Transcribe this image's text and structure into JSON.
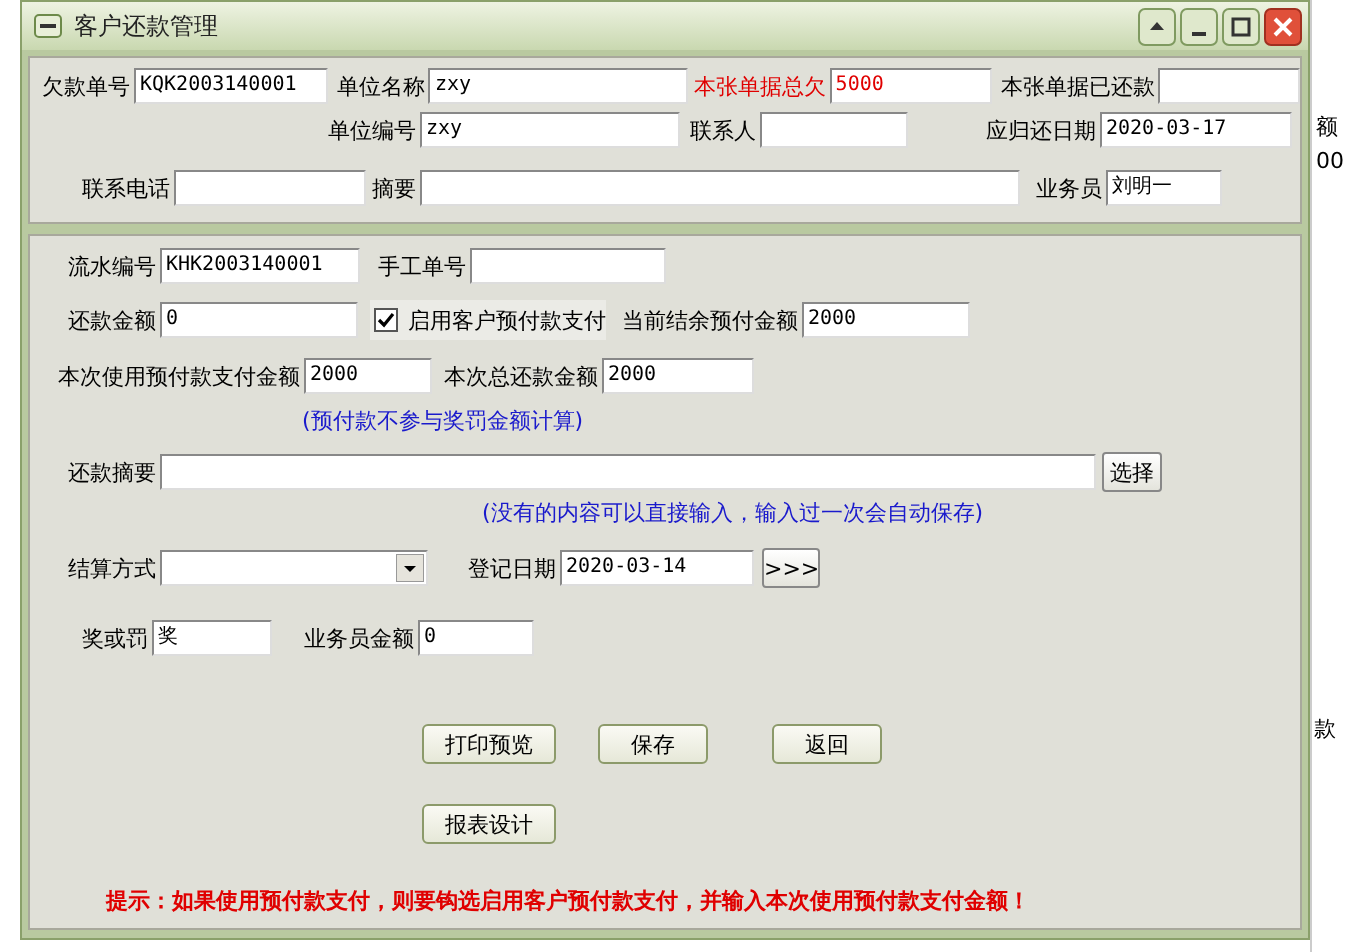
{
  "window": {
    "title": "客户还款管理"
  },
  "header": {
    "fields": [
      {
        "label": "欠款单号",
        "value": "KQK2003140001"
      },
      {
        "label": "单位名称",
        "value": "zxy"
      },
      {
        "label": "本张单据总欠",
        "value": "5000",
        "color": "#e00000"
      },
      {
        "label": "本张单据已还款"
      },
      {
        "label": "单位编号",
        "value": "zxy"
      },
      {
        "label": "联系人"
      },
      {
        "label": "应归还日期",
        "value": "2020-03-17"
      },
      {
        "label": "联系电话"
      },
      {
        "label": "摘要"
      },
      {
        "label": "业务员",
        "value": "刘明一"
      }
    ]
  },
  "form": {
    "rows": [
      [
        {
          "kind": "field",
          "label": "流水编号",
          "value": "KHK2003140001"
        },
        {
          "kind": "field",
          "label": "手工单号"
        }
      ],
      [
        {
          "kind": "field",
          "label": "还款金额",
          "value": "0"
        },
        {
          "kind": "checkbox",
          "label": "启用客户预付款支付",
          "checked": true
        },
        {
          "kind": "field",
          "label": "当前结余预付金额",
          "value": "2000"
        }
      ],
      [
        {
          "kind": "field",
          "label": "本次使用预付款支付金额",
          "value": "2000"
        },
        {
          "kind": "field",
          "label": "本次总还款金额",
          "value": "2000"
        }
      ],
      [
        {
          "kind": "note",
          "text": "(预付款不参与奖罚金额计算)"
        }
      ],
      [
        {
          "kind": "field",
          "label": "还款摘要"
        },
        {
          "kind": "button",
          "label": "选择"
        }
      ],
      [
        {
          "kind": "note",
          "text": "(没有的内容可以直接输入，输入过一次会自动保存)"
        }
      ],
      [
        {
          "kind": "dropdown",
          "label": "结算方式"
        },
        {
          "kind": "field",
          "label": "登记日期",
          "value": "2020-03-14"
        },
        {
          "kind": "button",
          "label": ">>>"
        }
      ],
      [
        {
          "kind": "field",
          "label": "奖或罚",
          "value": "奖"
        },
        {
          "kind": "field",
          "label": "业务员金额",
          "value": "0"
        }
      ],
      [
        {
          "kind": "button",
          "label": "打印预览"
        },
        {
          "kind": "button",
          "label": "保存"
        },
        {
          "kind": "button",
          "label": "返回"
        }
      ],
      [
        {
          "kind": "button",
          "label": "报表设计"
        }
      ],
      [
        {
          "kind": "tip",
          "text": "提示：如果使用预付款支付，则要钩选启用客户预付款支付，并输入本次使用预付款支付金额！"
        }
      ]
    ]
  },
  "background_window": {
    "texts": [
      "额",
      "00",
      "款"
    ]
  }
}
